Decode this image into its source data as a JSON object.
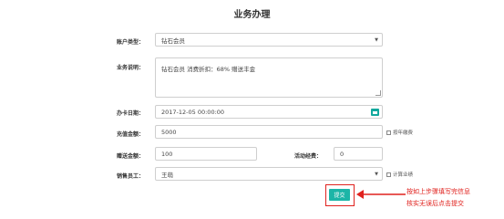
{
  "page": {
    "title": "业务办理"
  },
  "form": {
    "account_type": {
      "label": "账户类型：",
      "value": "钻石会员"
    },
    "business_desc": {
      "label": "业务说明：",
      "value": "钻石会员  消费折扣：68%   赠送丰金"
    },
    "card_date": {
      "label": "办卡日期：",
      "value": "2017-12-05 00:00:00"
    },
    "recharge": {
      "label": "充值金额：",
      "value": "5000",
      "checkbox": "按年缴费"
    },
    "gift": {
      "label": "赠送金额：",
      "value": "100"
    },
    "event": {
      "label": "活动经费：",
      "value": "0"
    },
    "staff": {
      "label": "销售员工：",
      "value": "王萌",
      "checkbox": "计算业绩"
    },
    "submit_label": "提交"
  },
  "annotation": {
    "line1": "按如上步骤填写完信息",
    "line2": "核实无误后点击提交",
    "color": "#e0221e"
  },
  "colors": {
    "accent": "#1cb5a7"
  }
}
